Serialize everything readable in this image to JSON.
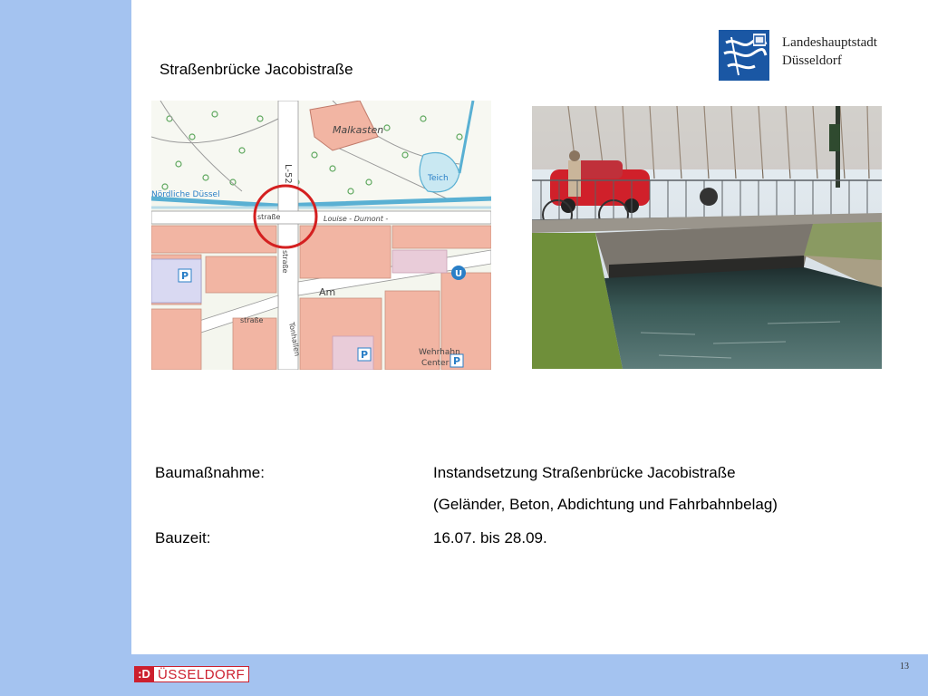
{
  "slide": {
    "title": "Straßenbrücke Jacobistraße",
    "page_number": "13"
  },
  "logo": {
    "line1": "Landeshauptstadt",
    "line2": "Düsseldorf"
  },
  "map_labels": {
    "malkasten": "Malkasten",
    "teich": "Teich",
    "duessel": "Nördliche Düssel",
    "l52": "L-52",
    "strasse_left": "straße",
    "louise_dumont": "Louise - Dumont -",
    "strasse_vert": "straße",
    "am": "Am",
    "strasse_bottom": "straße",
    "tonhallen": "Tonhallen",
    "wehrhahn": "Wehrhahn",
    "center": "Center",
    "parking_p": "P",
    "ubahn_u": "U"
  },
  "details": {
    "label_measure": "Baumaßnahme:",
    "value_measure_1": "Instandsetzung Straßenbrücke Jacobistraße",
    "value_measure_2": "(Geländer, Beton, Abdichtung und Fahrbahnbelag)",
    "label_time": "Bauzeit:",
    "value_time": "16.07. bis 28.09."
  },
  "footer": {
    "brand_mark": ":D",
    "brand_text": "ÜSSELDORF"
  },
  "colors": {
    "sidebar": "#a4c3f0",
    "brand_red": "#cc1f2e",
    "logo_blue": "#1a57a4",
    "map_circle": "#d42020"
  }
}
